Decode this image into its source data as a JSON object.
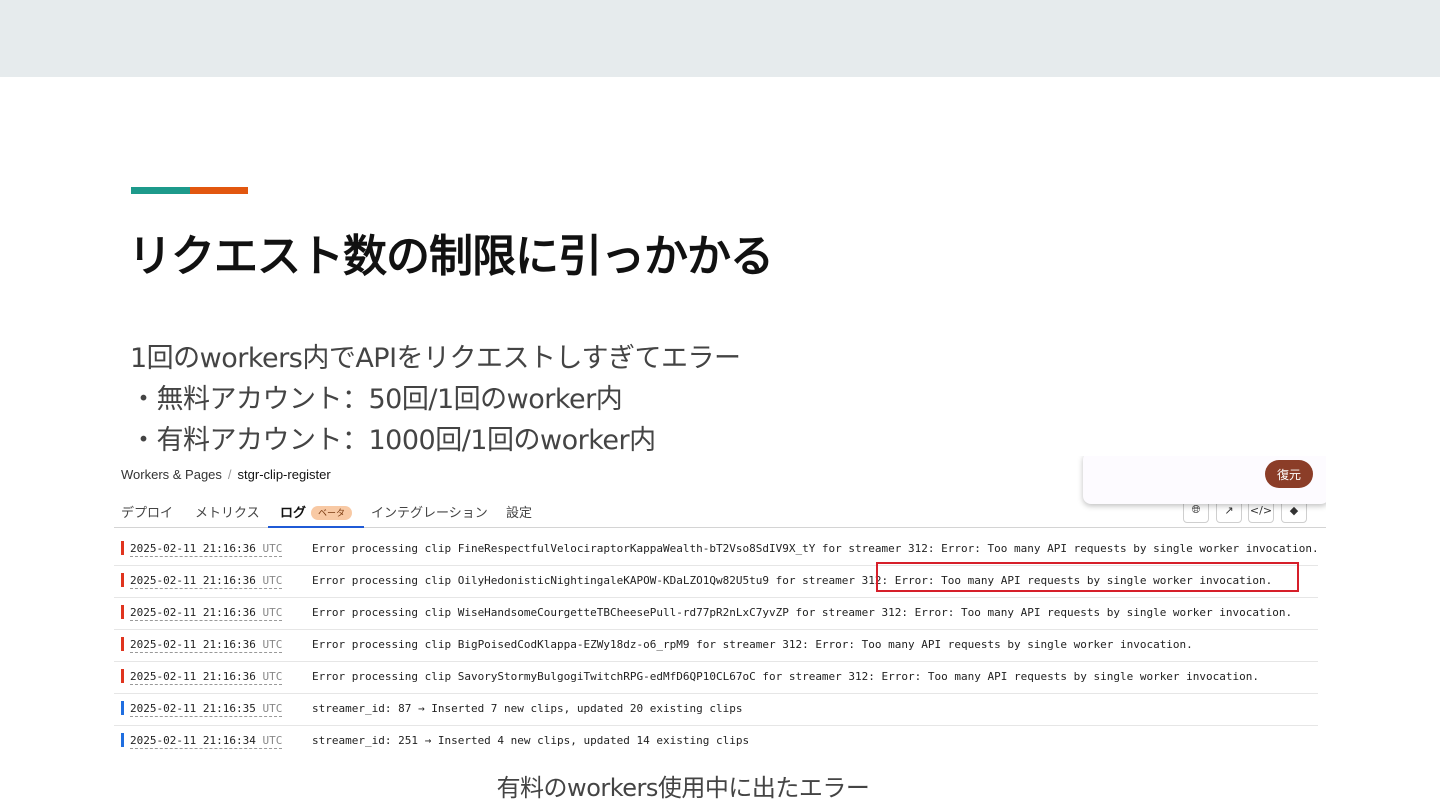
{
  "slide": {
    "title": "リクエスト数の制限に引っかかる",
    "body": [
      "1回のworkers内でAPIをリクエストしすぎてエラー",
      "・無料アカウント：50回/1回のworker内",
      "・有料アカウント：1000回/1回のworker内"
    ],
    "caption": "有料のworkers使用中に出たエラー",
    "accent_colors": [
      "#1d9a8b",
      "#e2570f"
    ]
  },
  "dashboard": {
    "breadcrumb": {
      "root": "Workers & Pages",
      "separator": "/",
      "current": "stgr-clip-register"
    },
    "tabs": [
      {
        "label": "デプロイ"
      },
      {
        "label": "メトリクス"
      },
      {
        "label": "ログ",
        "badge": "ベータ",
        "active": true
      },
      {
        "label": "インテグレーション"
      },
      {
        "label": "設定"
      }
    ],
    "toolbar_icons": [
      "globe-icon",
      "external-link-icon",
      "code-icon",
      "git-icon"
    ],
    "restore_button": "復元",
    "logs": [
      {
        "level": "error",
        "date": "2025-02-11 21:16:36",
        "tz": "UTC",
        "message": "Error processing clip FineRespectfulVelociraptorKappaWealth-bT2Vso8SdIV9X_tY for streamer 312: Error: Too many API requests by single worker invocation."
      },
      {
        "level": "error",
        "date": "2025-02-11 21:16:36",
        "tz": "UTC",
        "message": "Error processing clip OilyHedonisticNightingaleKAPOW-KDaLZO1Qw82U5tu9 for streamer 312: Error: Too many API requests by single worker invocation."
      },
      {
        "level": "error",
        "date": "2025-02-11 21:16:36",
        "tz": "UTC",
        "message": "Error processing clip WiseHandsomeCourgetteTBCheesePull-rd77pR2nLxC7yvZP for streamer 312: Error: Too many API requests by single worker invocation."
      },
      {
        "level": "error",
        "date": "2025-02-11 21:16:36",
        "tz": "UTC",
        "message": "Error processing clip BigPoisedCodKlappa-EZWy18dz-o6_rpM9 for streamer 312: Error: Too many API requests by single worker invocation."
      },
      {
        "level": "error",
        "date": "2025-02-11 21:16:36",
        "tz": "UTC",
        "message": "Error processing clip SavoryStormyBulgogiTwitchRPG-edMfD6QP10CL67oC for streamer 312: Error: Too many API requests by single worker invocation."
      },
      {
        "level": "info",
        "date": "2025-02-11 21:16:35",
        "tz": "UTC",
        "message": "streamer_id: 87 → Inserted 7 new clips, updated 20 existing clips"
      },
      {
        "level": "info",
        "date": "2025-02-11 21:16:34",
        "tz": "UTC",
        "message": "streamer_id: 251 → Inserted 4 new clips, updated 14 existing clips"
      }
    ],
    "level_colors": {
      "error": "#e0341e",
      "info": "#1f6ee0"
    },
    "highlight_color": "#d61f2a"
  }
}
